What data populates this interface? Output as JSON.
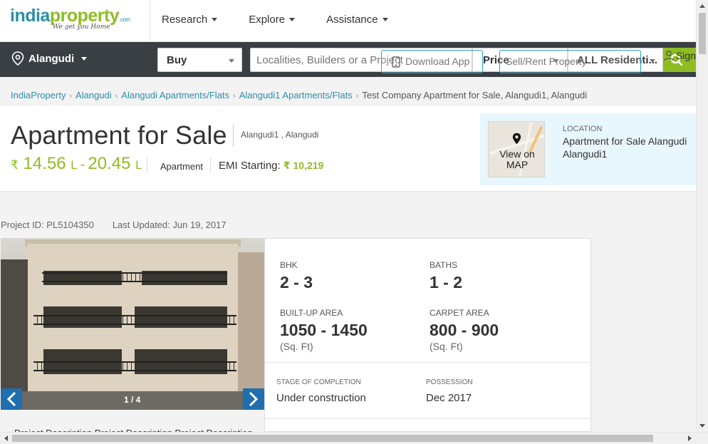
{
  "header": {
    "logo_part1": "india",
    "logo_part2": "property",
    "logo_com": ".com",
    "logo_tagline": "We get you Home",
    "nav": [
      {
        "label": "Research"
      },
      {
        "label": "Explore"
      },
      {
        "label": "Assistance"
      }
    ]
  },
  "searchbar": {
    "location": "Alangudi",
    "type_select": "Buy",
    "search_placeholder": "Localities, Builders or a Project",
    "price_label": "Price",
    "residential_label": "ALL Residenti...",
    "overlay_download": "Download App",
    "overlay_sell": "Sell/Rent Property",
    "sign_in": "Sign"
  },
  "breadcrumb": [
    "IndiaProperty",
    "Alangudi",
    "Alangudi Apartments/Flats",
    "Alangudi1 Apartments/Flats",
    "Test Company Apartment for Sale, Alangudi1, Alangudi"
  ],
  "listing": {
    "title": "Apartment for Sale",
    "title_location": "Alangudi1 , Alangudi",
    "currency_symbol": "₹",
    "price_min": "14.56",
    "price_min_unit": "L",
    "price_max": "20.45",
    "price_max_unit": "L",
    "price_dash": "-",
    "property_type": "Apartment",
    "emi_label": "EMI Starting:",
    "emi_value": "₹ 10,219"
  },
  "map_card": {
    "button_text": "View on MAP",
    "label": "LOCATION",
    "address": "Apartment for Sale Alangudi Alangudi1"
  },
  "meta": {
    "project_id": "Project ID: PL5104350",
    "last_updated": "Last Updated: Jun 19, 2017"
  },
  "gallery": {
    "counter": "1 / 4"
  },
  "details": {
    "bhk_label": "BHK",
    "bhk_value": "2 - 3",
    "baths_label": "BATHS",
    "baths_value": "1 - 2",
    "builtup_label": "BUILT-UP AREA",
    "builtup_value": "1050 - 1450",
    "builtup_unit": "(Sq. Ft)",
    "carpet_label": "CARPET AREA",
    "carpet_value": "800 - 900",
    "carpet_unit": "(Sq. Ft)",
    "stage_label": "STAGE OF COMPLETION",
    "stage_value": "Under construction",
    "possession_label": "POSSESSION",
    "possession_value": "Dec 2017"
  },
  "description_peek": "Project Description Project Description Project Description",
  "colors": {
    "brand_teal": "#2b8fa8",
    "brand_green": "#8dbd23",
    "dark_bar": "#3a3f44",
    "arrow_blue": "#1f6fae",
    "map_card_bg": "#e8f6fd"
  }
}
